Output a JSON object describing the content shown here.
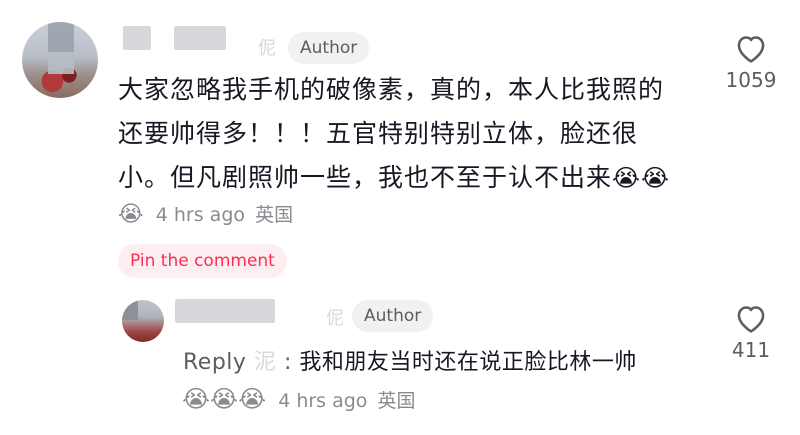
{
  "comment": {
    "author_badge": "Author",
    "author_ghost_char": "伲",
    "text_lines": [
      "大家忽略我手机的破像素，真的，本人比我照的",
      "还要帅得多！！！五官特别特别立体，脸还很",
      "小。但凡剧照帅一些，我也不至于认不出来"
    ],
    "trailing_emoji": "😭😭",
    "meta_emoji": "😭",
    "time": "4 hrs ago",
    "location": "英国",
    "likes": "1059",
    "pin_label": "Pin the comment"
  },
  "reply": {
    "author_badge": "Author",
    "author_ghost_char": "伲",
    "prefix": "Reply",
    "prefix_ghost": "泥",
    "colon": ":",
    "text": "我和朋友当时还在说正脸比林一帅",
    "emoji": "😭😭😭",
    "time": "4 hrs ago",
    "location": "英国",
    "likes": "411"
  },
  "icons": {
    "like": "heart-outline-icon",
    "emoji": "crying-face-icon"
  }
}
